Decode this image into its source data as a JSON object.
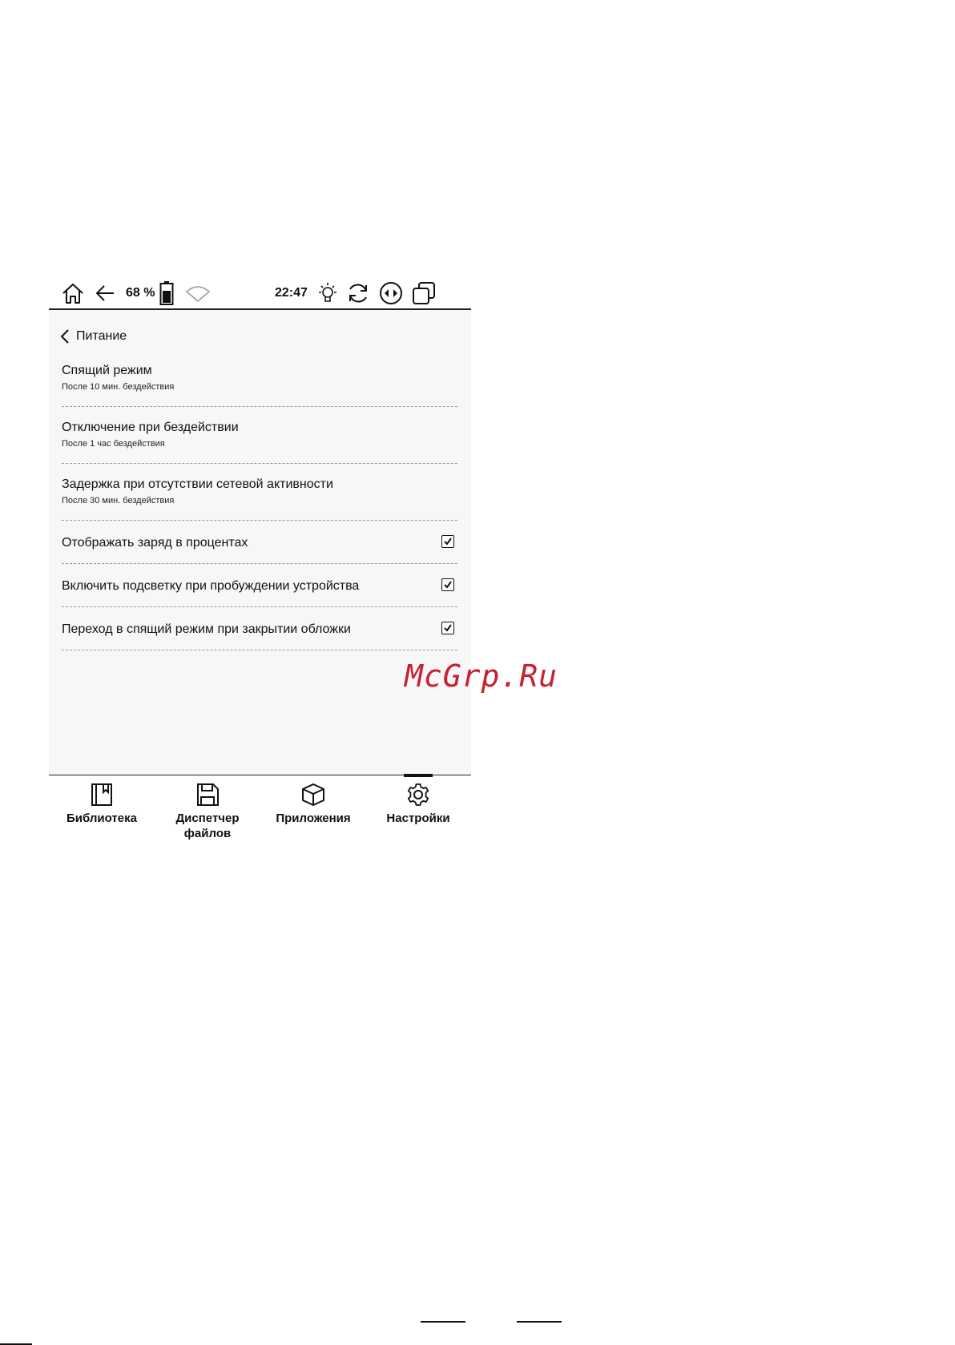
{
  "status_bar": {
    "battery_percent": "68 %",
    "time": "22:47"
  },
  "header": {
    "back_label": "Питание"
  },
  "settings": {
    "items": [
      {
        "title": "Спящий режим",
        "subtitle": "После 10 мин. бездействия"
      },
      {
        "title": "Отключение при бездействии",
        "subtitle": "После 1 час бездействия"
      },
      {
        "title": "Задержка при отсутствии сетевой активности",
        "subtitle": "После 30 мин. бездействия"
      },
      {
        "title": "Отображать заряд в процентах",
        "checked": true
      },
      {
        "title": "Включить подсветку при пробуждении устройства",
        "checked": true
      },
      {
        "title": "Переход в спящий режим при закрытии обложки",
        "checked": true
      }
    ]
  },
  "bottom_nav": {
    "items": [
      {
        "label": "Библиотека",
        "icon": "library-icon"
      },
      {
        "label": "Диспетчер\nфайлов",
        "icon": "save-file-icon"
      },
      {
        "label": "Приложения",
        "icon": "box-icon"
      },
      {
        "label": "Настройки",
        "icon": "gear-icon",
        "active": true
      }
    ]
  },
  "watermark": "McGrp.Ru"
}
